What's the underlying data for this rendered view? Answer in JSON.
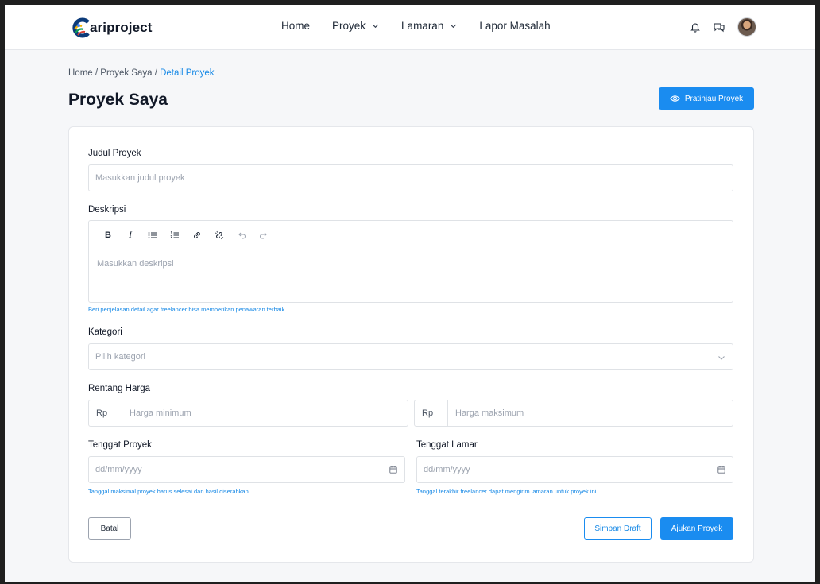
{
  "brand": {
    "name": "ariproject"
  },
  "nav": {
    "items": [
      {
        "label": "Home",
        "dropdown": false
      },
      {
        "label": "Proyek",
        "dropdown": true
      },
      {
        "label": "Lamaran",
        "dropdown": true
      },
      {
        "label": "Lapor Masalah",
        "dropdown": false
      }
    ],
    "icons": [
      "bell-icon",
      "chat-icon",
      "avatar"
    ]
  },
  "breadcrumb": {
    "home": "Home",
    "sep": "/",
    "parent": "Proyek Saya",
    "current": "Detail Proyek"
  },
  "page": {
    "title": "Proyek Saya",
    "preview_label": "Pratinjau Proyek"
  },
  "form": {
    "title": {
      "label": "Judul Proyek",
      "placeholder": "Masukkan judul proyek"
    },
    "description": {
      "label": "Deskripsi",
      "placeholder": "Masukkan deskripsi",
      "help": "Beri penjelasan detail agar freelancer bisa memberikan penawaran terbaik.",
      "toolbar": [
        "B",
        "I",
        "bullet-list-icon",
        "ordered-list-icon",
        "link-icon",
        "unlink-icon",
        "undo-icon",
        "redo-icon"
      ]
    },
    "category": {
      "label": "Kategori",
      "placeholder": "Pilih kategori"
    },
    "price": {
      "label": "Rentang Harga",
      "currency": "Rp",
      "min_placeholder": "Harga minimum",
      "max_placeholder": "Harga maksimum"
    },
    "project_deadline": {
      "label": "Tenggat Proyek",
      "placeholder": "dd/mm/yyyy",
      "help": "Tanggal maksimal proyek harus selesai dan hasil diserahkan."
    },
    "apply_deadline": {
      "label": "Tenggat Lamar",
      "placeholder": "dd/mm/yyyy",
      "help": "Tanggal terakhir freelancer dapat mengirim lamaran untuk proyek ini."
    },
    "actions": {
      "cancel": "Batal",
      "draft": "Simpan Draft",
      "submit": "Ajukan Proyek"
    }
  },
  "colors": {
    "primary": "#1a8cf0",
    "text": "#111827",
    "border": "#dfe2e6",
    "background": "#f6f7f9"
  }
}
